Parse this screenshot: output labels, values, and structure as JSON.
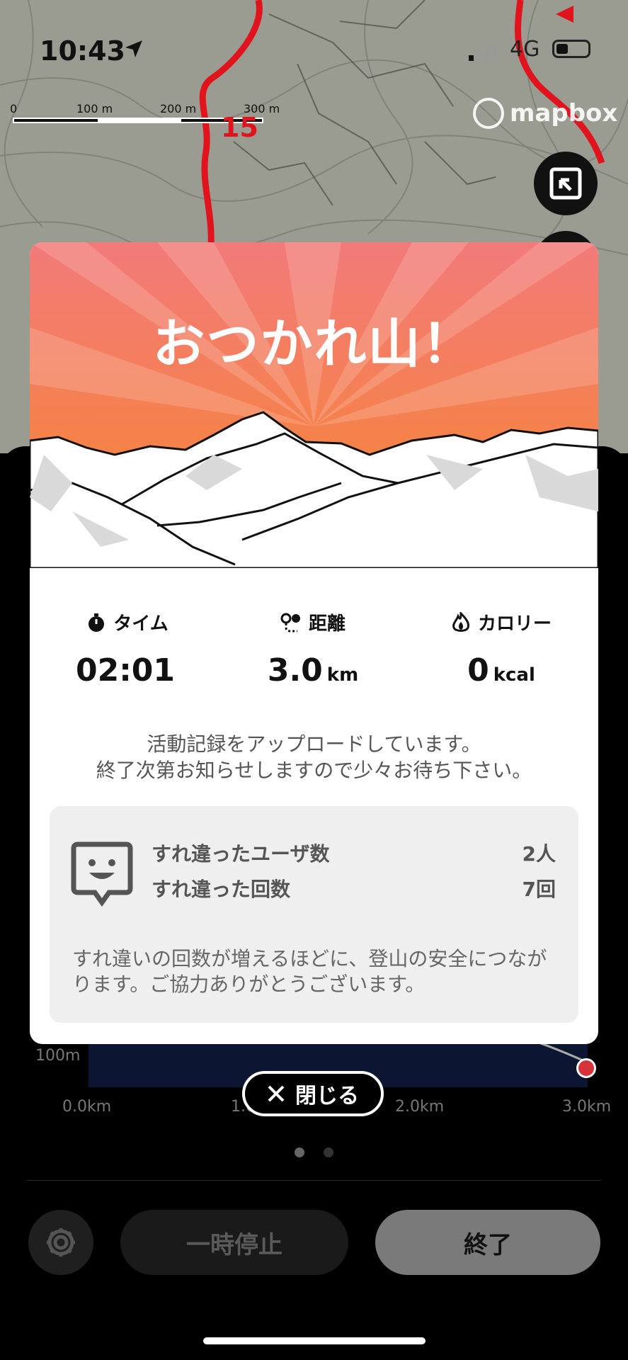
{
  "status_bar": {
    "time": "10:43",
    "network": "4G"
  },
  "map": {
    "scale_labels": [
      "0",
      "100 m",
      "200 m",
      "300 m"
    ],
    "route_marker": "15",
    "attribution": "mapbox",
    "icons": [
      "location-arrow-icon",
      "collapse-map-icon"
    ]
  },
  "modal": {
    "title": "おつかれ山！",
    "stats": [
      {
        "icon": "stopwatch-icon",
        "label": "タイム",
        "value": "02:01",
        "unit": ""
      },
      {
        "icon": "route-icon",
        "label": "距離",
        "value": "3.0",
        "unit": "km"
      },
      {
        "icon": "flame-icon",
        "label": "カロリー",
        "value": "0",
        "unit": "kcal"
      }
    ],
    "upload_message_line1": "活動記録をアップロードしています。",
    "upload_message_line2": "終了次第お知らせしますので少々お待ち下さい。",
    "passing": {
      "users_label": "すれ違ったユーザ数",
      "users_value": "2人",
      "count_label": "すれ違った回数",
      "count_value": "7回",
      "note": "すれ違いの回数が増えるほどに、登山の安全につながります。ご協力ありがとうございます。"
    },
    "close_label": "閉じる"
  },
  "elevation_chart": {
    "y_label": "100m",
    "x_labels": [
      "0.0km",
      "1.0km",
      "2.0km",
      "3.0km"
    ]
  },
  "page_indicator": {
    "count": 2,
    "active": 0
  },
  "controls": {
    "pause_label": "一時停止",
    "end_label": "終了"
  },
  "colors": {
    "hero_top": "#f27a7a",
    "hero_bottom": "#f7862c",
    "route": "#e1141e"
  }
}
